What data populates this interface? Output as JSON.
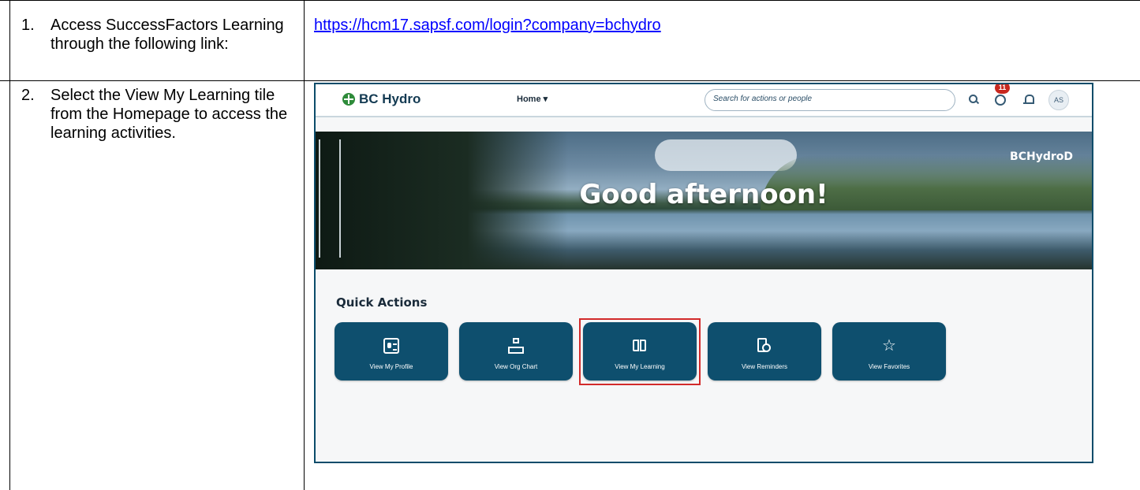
{
  "steps": [
    {
      "number": "1.",
      "text": "Access SuccessFactors Learning through the following link:"
    },
    {
      "number": "2.",
      "text": "Select the View My Learning tile from the Homepage to access the learning activities."
    }
  ],
  "link": {
    "text": "https://hcm17.sapsf.com/login?company=bchydro"
  },
  "screenshot": {
    "logo_text": "BC Hydro",
    "nav": {
      "home_label": "Home"
    },
    "search": {
      "placeholder": "Search for actions or people"
    },
    "todo_badge": "11",
    "avatar_initials": "AS",
    "tenant_label": "BCHydroD",
    "greeting": "Good afternoon!",
    "quick_actions": {
      "title": "Quick Actions",
      "tiles": [
        {
          "label": "View My Profile",
          "icon": "profile-card-icon"
        },
        {
          "label": "View Org Chart",
          "icon": "org-chart-icon"
        },
        {
          "label": "View My Learning",
          "icon": "book-icon"
        },
        {
          "label": "View Reminders",
          "icon": "reminder-clock-icon"
        },
        {
          "label": "View Favorites",
          "icon": "star-list-icon"
        }
      ]
    },
    "colors": {
      "tile": "#0e4f6e",
      "highlight": "#d22a2a",
      "badge": "#c8281f"
    }
  }
}
